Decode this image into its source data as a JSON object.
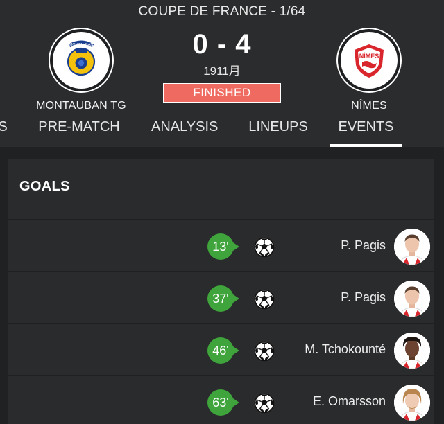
{
  "match": {
    "competition": "COUPE DE FRANCE - 1/64",
    "score": "0 - 4",
    "date": "1911月",
    "status": "FINISHED",
    "status_color": "#ef6a60"
  },
  "home_team": {
    "name": "MONTAUBAN TG",
    "crest_icon": "montauban-crest-icon",
    "crest_text": "MONTAUBAN"
  },
  "away_team": {
    "name": "NÎMES",
    "crest_icon": "nimes-crest-icon",
    "crest_text": "NÎMES"
  },
  "tabs": [
    {
      "label": "S",
      "active": false
    },
    {
      "label": "PRE-MATCH",
      "active": false
    },
    {
      "label": "ANALYSIS",
      "active": false
    },
    {
      "label": "LINEUPS",
      "active": false
    },
    {
      "label": "EVENTS",
      "active": true
    }
  ],
  "goals": {
    "title": "GOALS",
    "accent": "#3fa43b",
    "events": [
      {
        "minute": "13'",
        "icon": "soccer-ball-icon",
        "player": "P. Pagis"
      },
      {
        "minute": "37'",
        "icon": "soccer-ball-icon",
        "player": "P. Pagis"
      },
      {
        "minute": "46'",
        "icon": "soccer-ball-icon",
        "player": "M. Tchokounté"
      },
      {
        "minute": "63'",
        "icon": "soccer-ball-icon",
        "player": "E. Omarsson"
      }
    ]
  }
}
